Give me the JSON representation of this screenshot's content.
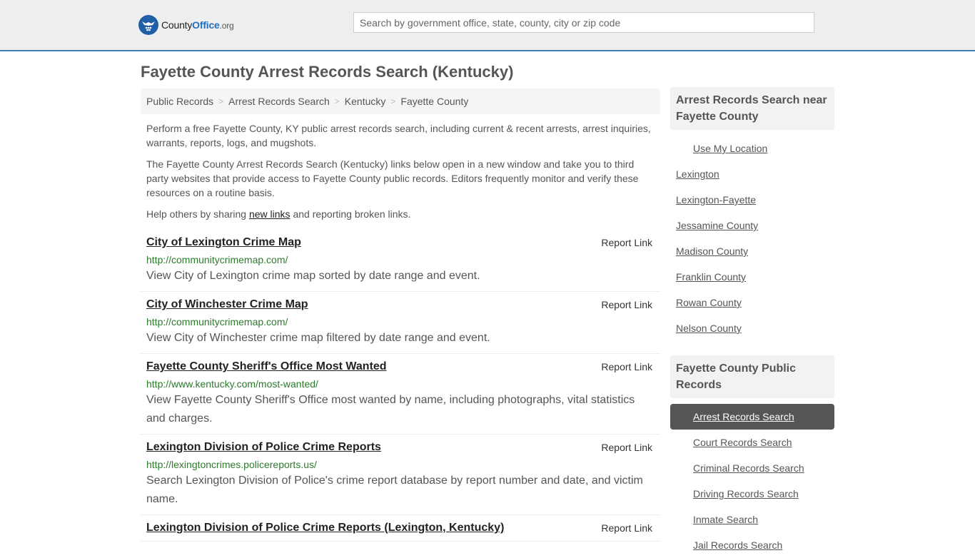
{
  "header": {
    "logo": {
      "name_part1": "County",
      "name_part2": "Office",
      "name_part3": ".org"
    },
    "search": {
      "placeholder": "Search by government office, state, county, city or zip code",
      "value": ""
    },
    "accent_color": "#3e7eb5"
  },
  "page": {
    "title": "Fayette County Arrest Records Search (Kentucky)"
  },
  "breadcrumb": [
    {
      "label": "Public Records"
    },
    {
      "label": "Arrest Records Search"
    },
    {
      "label": "Kentucky"
    },
    {
      "label": "Fayette County"
    }
  ],
  "intro": {
    "p1": "Perform a free Fayette County, KY public arrest records search, including current & recent arrests, arrest inquiries, warrants, reports, logs, and mugshots.",
    "p2": "The Fayette County Arrest Records Search (Kentucky) links below open in a new window and take you to third party websites that provide access to Fayette County public records. Editors frequently monitor and verify these resources on a routine basis.",
    "p3_before": "Help others by sharing ",
    "p3_link": "new links",
    "p3_after": " and reporting broken links."
  },
  "listings": [
    {
      "title": "City of Lexington Crime Map",
      "url": "http://communitycrimemap.com/",
      "description": "View City of Lexington crime map sorted by date range and event.",
      "report_label": "Report Link"
    },
    {
      "title": "City of Winchester Crime Map",
      "url": "http://communitycrimemap.com/",
      "description": "View City of Winchester crime map filtered by date range and event.",
      "report_label": "Report Link"
    },
    {
      "title": "Fayette County Sheriff's Office Most Wanted",
      "url": "http://www.kentucky.com/most-wanted/",
      "description": "View Fayette County Sheriff's Office most wanted by name, including photographs, vital statistics and charges.",
      "report_label": "Report Link"
    },
    {
      "title": "Lexington Division of Police Crime Reports",
      "url": "http://lexingtoncrimes.policereports.us/",
      "description": "Search Lexington Division of Police's crime report database by report number and date, and victim name.",
      "report_label": "Report Link"
    },
    {
      "title": "Lexington Division of Police Crime Reports (Lexington, Kentucky)",
      "url": "",
      "description": "",
      "report_label": "Report Link"
    }
  ],
  "sidebar": {
    "near": {
      "heading": "Arrest Records Search near Fayette County",
      "use_location": "Use My Location",
      "items": [
        "Lexington",
        "Lexington-Fayette",
        "Jessamine County",
        "Madison County",
        "Franklin County",
        "Rowan County",
        "Nelson County"
      ]
    },
    "public": {
      "heading": "Fayette County Public Records",
      "active_index": 0,
      "items": [
        "Arrest Records Search",
        "Court Records Search",
        "Criminal Records Search",
        "Driving Records Search",
        "Inmate Search",
        "Jail Records Search"
      ]
    }
  }
}
